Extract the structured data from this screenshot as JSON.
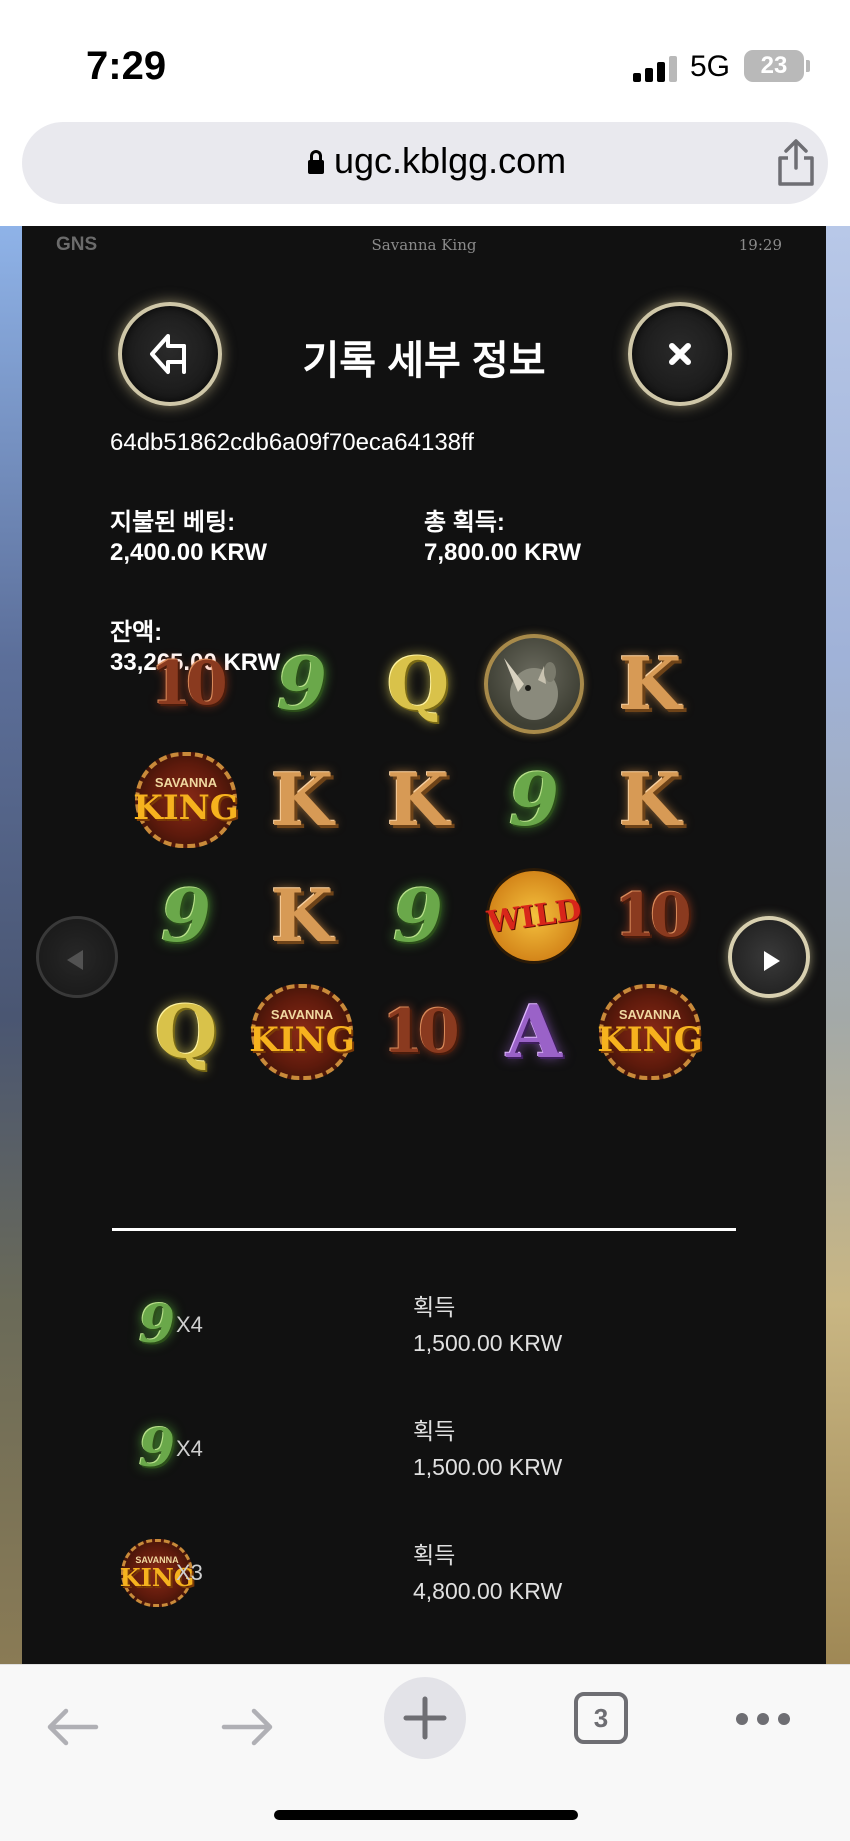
{
  "status_bar": {
    "time": "7:29",
    "network": "5G",
    "battery": "23"
  },
  "browser": {
    "url": "ugc.kblgg.com",
    "tab_count": "3"
  },
  "game": {
    "provider": "GNS",
    "title": "Savanna King",
    "clock": "19:29"
  },
  "record": {
    "heading": "기록 세부 정보",
    "id": "64db51862cdb6a09f70eca64138ff",
    "bet_label": "지불된 베팅:",
    "bet_value": "2,400.00 KRW",
    "win_label": "총 획득:",
    "win_value": "7,800.00 KRW",
    "balance_label": "잔액:",
    "balance_value": "33,265.00 KRW"
  },
  "symbols": {
    "ten": "10",
    "nine": "9",
    "queen": "Q",
    "king_letter": "K",
    "ace": "A",
    "wild": "WILD",
    "logo_top": "SAVANNA",
    "logo_bottom": "KING"
  },
  "grid": [
    [
      "10",
      "9",
      "Q",
      "rhino",
      "K"
    ],
    [
      "savanna-king",
      "K",
      "K",
      "9",
      "K"
    ],
    [
      "9",
      "K",
      "9",
      "wild",
      "10"
    ],
    [
      "Q",
      "savanna-king",
      "10",
      "A",
      "savanna-king"
    ]
  ],
  "wins": [
    {
      "symbol": "9",
      "count": "X4",
      "label": "획득",
      "amount": "1,500.00 KRW"
    },
    {
      "symbol": "9",
      "count": "X4",
      "label": "획득",
      "amount": "1,500.00 KRW"
    },
    {
      "symbol": "savanna-king",
      "count": "X3",
      "label": "획득",
      "amount": "4,800.00 KRW"
    }
  ],
  "icons": {
    "back": "back-arrow-icon",
    "close": "close-x-icon",
    "prev": "triangle-left-icon",
    "next": "triangle-right-icon",
    "lock": "lock-icon",
    "share": "share-icon"
  }
}
